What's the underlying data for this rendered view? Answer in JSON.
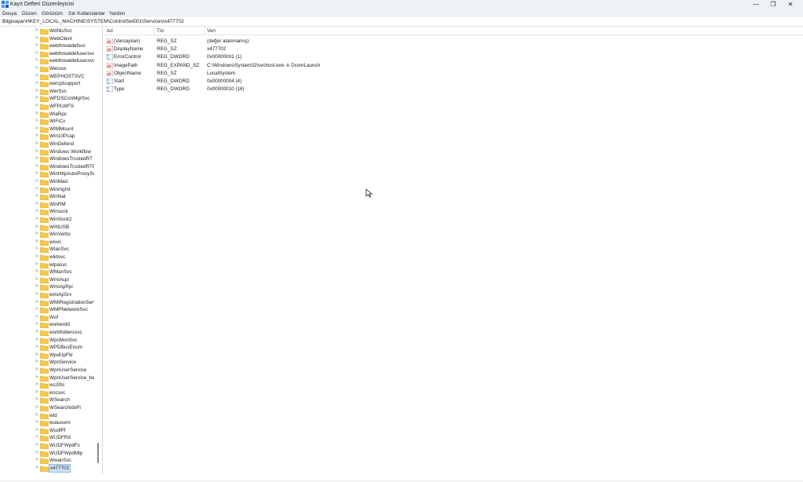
{
  "window": {
    "title": "Kayıt Defteri Düzenleyicisi",
    "minimize_glyph": "—",
    "maximize_glyph": "❐",
    "close_glyph": "✕"
  },
  "menu": [
    "Dosya",
    "Düzen",
    "Görünüm",
    "Sık Kullanılanlar",
    "Yardım"
  ],
  "address": "Bilgisayar\\HKEY_LOCAL_MACHINE\\SYSTEM\\ControlSet001\\Services\\x477702",
  "tree": {
    "items": [
      "WdNisSvc",
      "WebClient",
      "webthreatdefsvc",
      "webthreatdefusersvc",
      "webthreatdefusersvc",
      "Wecsvc",
      "WEPHOSTSVC",
      "wercplsupport",
      "WerSvc",
      "WFDSConMgrSvc",
      "WFPLWFS",
      "WiaRpc",
      "WiFiCx",
      "WIMMount",
      "Win10Pcap",
      "WinDefend",
      "Windows Workflow",
      "WindowsTrustedRT",
      "WindowsTrustedRTP",
      "WinHttpAutoProxySv",
      "WinMad",
      "Winmgmt",
      "WinNat",
      "WinRM",
      "Winsock",
      "WinSock2",
      "WINUSB",
      "WinVerbs",
      "wisvc",
      "WlanSvc",
      "wlidsvc",
      "wlpasvc",
      "WManSvc",
      "WmiAcpi",
      "WmiApRpl",
      "wmiApSrv",
      "WMIRegistrationServ",
      "WMPNetworkSvc",
      "Wof",
      "workerdd",
      "workfolderssvc",
      "WpcMonSvc",
      "WPDBusEnum",
      "WpdUpFltr",
      "WpnService",
      "WpnUserService",
      "WpnUserService_be",
      "ws2ifsl",
      "wscsvc",
      "WSearch",
      "WSearchIdxPi",
      "wtd",
      "wuauserv",
      "WudfPf",
      "WUDFRd",
      "WUDFWpdFs",
      "WUDFWpdMtp",
      "WwanSvc",
      "x477702"
    ],
    "selected": "x477702"
  },
  "list": {
    "headers": {
      "name": "Ad",
      "type": "Tür",
      "data": "Veri"
    },
    "rows": [
      {
        "icon": "string-value-icon",
        "name": "(Varsayılan)",
        "type": "REG_SZ",
        "data": "(değer atanmamış)"
      },
      {
        "icon": "string-value-icon",
        "name": "DisplayName",
        "type": "REG_SZ",
        "data": "x477702"
      },
      {
        "icon": "binary-value-icon",
        "name": "ErrorControl",
        "type": "REG_DWORD",
        "data": "0x00000001 (1)"
      },
      {
        "icon": "string-value-icon",
        "name": "ImagePath",
        "type": "REG_EXPAND_SZ",
        "data": "C:\\Windows\\System32\\svchost.exe -k DcomLaunch"
      },
      {
        "icon": "string-value-icon",
        "name": "ObjectName",
        "type": "REG_SZ",
        "data": "LocalSystem"
      },
      {
        "icon": "binary-value-icon",
        "name": "Start",
        "type": "REG_DWORD",
        "data": "0x00000004 (4)"
      },
      {
        "icon": "binary-value-icon",
        "name": "Type",
        "type": "REG_DWORD",
        "data": "0x00000010 (16)"
      }
    ]
  },
  "colors": {
    "chrome_bg": "#eef2f7",
    "selection": "#cce4f7",
    "folder": "#f3c94e"
  }
}
